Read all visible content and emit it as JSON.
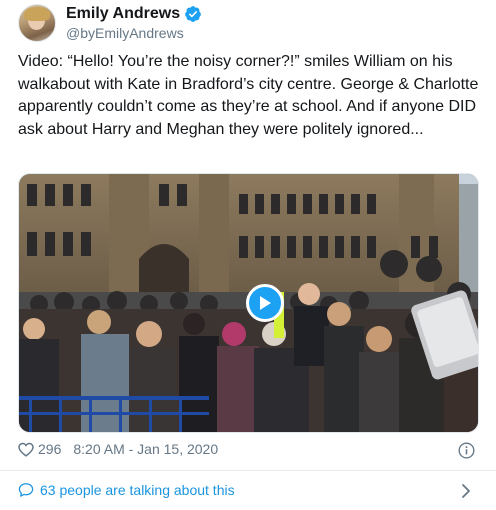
{
  "author": {
    "display_name": "Emily Andrews",
    "handle": "@byEmilyAndrews",
    "verified": true,
    "avatar_icon": "profile-photo"
  },
  "tweet": {
    "text": "Video: “Hello! You’re the noisy corner?!” smiles William on his walkabout with Kate in Bradford’s city centre. George & Charlotte apparently couldn’t come as they’re at school. And if anyone DID ask about Harry and Meghan they were politely ignored..."
  },
  "media": {
    "type": "video",
    "play_icon": "play-icon",
    "accent_color": "#1da1f2"
  },
  "footer": {
    "like_icon": "heart-icon",
    "like_count": "296",
    "timestamp": "8:20 AM - Jan 15, 2020",
    "info_icon": "info-icon"
  },
  "conversation": {
    "icon": "speech-bubble-icon",
    "label": "63 people are talking about this",
    "chevron_icon": "chevron-right-icon",
    "link_color": "#1b95e0"
  }
}
